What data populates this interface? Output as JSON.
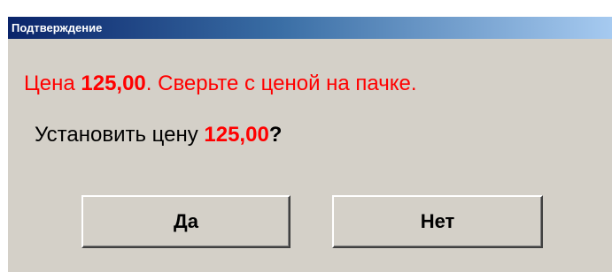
{
  "dialog": {
    "title": "Подтверждение"
  },
  "message": {
    "line1_prefix": "Цена ",
    "line1_price": "125,00",
    "line1_suffix": ". Сверьте с ценой на пачке.",
    "line2_prefix": "Установить цену ",
    "line2_price": "125,00",
    "line2_suffix": "?"
  },
  "buttons": {
    "yes_label": "Да",
    "no_label": "Нет"
  },
  "colors": {
    "dialog_background": "#d4d0c8",
    "titlebar_start": "#0a246a",
    "titlebar_end": "#a6caf0",
    "warning_text": "#ff0000"
  }
}
